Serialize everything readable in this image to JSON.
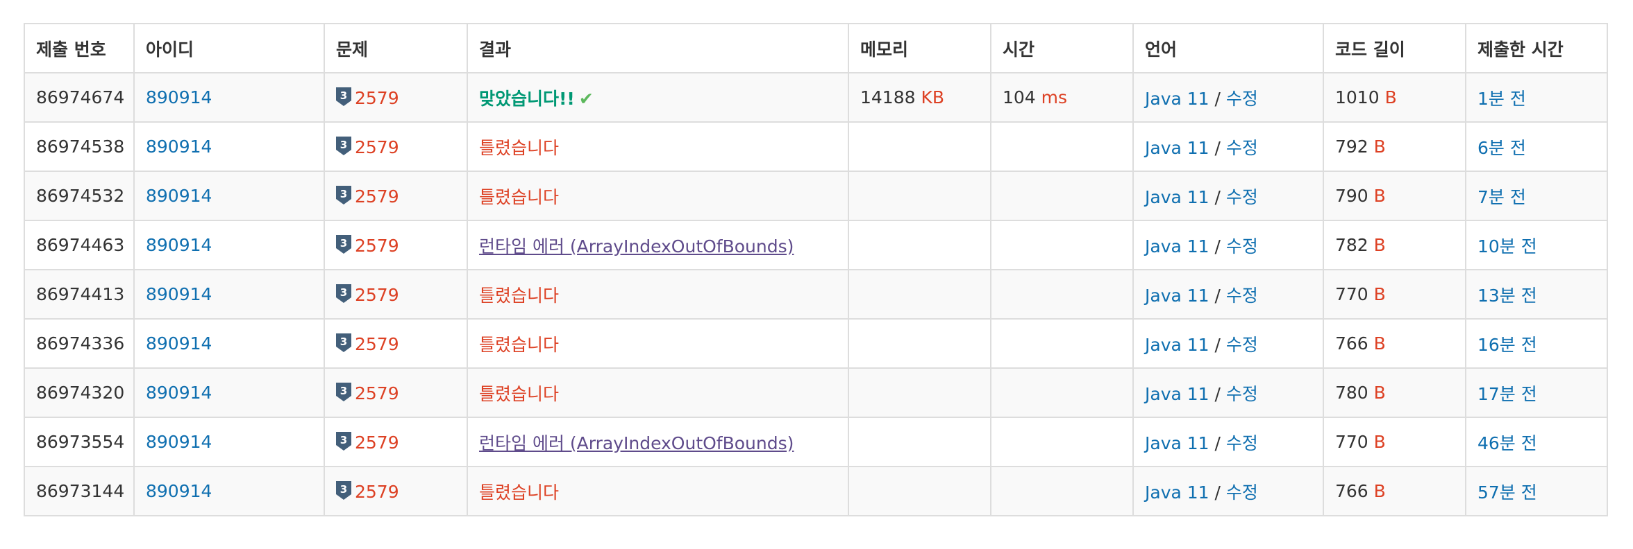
{
  "columns": {
    "submission_id": "제출 번호",
    "user_id": "아이디",
    "problem": "문제",
    "result": "결과",
    "memory": "메모리",
    "time": "시간",
    "language": "언어",
    "code_length": "코드 길이",
    "submitted_at": "제출한 시간"
  },
  "tier_badge": {
    "icon": "silver-tier-badge-icon",
    "level": "3",
    "color": "#435f7a"
  },
  "rows": [
    {
      "submission_id": "86974674",
      "user_id": "890914",
      "problem": "2579",
      "result": "맞았습니다!!",
      "result_type": "accepted",
      "result_icon": "✔",
      "memory": "14188",
      "memory_unit": "KB",
      "time": "104",
      "time_unit": "ms",
      "language": "Java 11",
      "separator": "/",
      "edit": "수정",
      "code_length": "1010",
      "code_unit": "B",
      "submitted_at": "1분 전"
    },
    {
      "submission_id": "86974538",
      "user_id": "890914",
      "problem": "2579",
      "result": "틀렸습니다",
      "result_type": "wrong",
      "memory": "",
      "memory_unit": "",
      "time": "",
      "time_unit": "",
      "language": "Java 11",
      "separator": "/",
      "edit": "수정",
      "code_length": "792",
      "code_unit": "B",
      "submitted_at": "6분 전"
    },
    {
      "submission_id": "86974532",
      "user_id": "890914",
      "problem": "2579",
      "result": "틀렸습니다",
      "result_type": "wrong",
      "memory": "",
      "memory_unit": "",
      "time": "",
      "time_unit": "",
      "language": "Java 11",
      "separator": "/",
      "edit": "수정",
      "code_length": "790",
      "code_unit": "B",
      "submitted_at": "7분 전"
    },
    {
      "submission_id": "86974463",
      "user_id": "890914",
      "problem": "2579",
      "result": "런타임 에러 (ArrayIndexOutOfBounds)",
      "result_type": "runtime-error",
      "memory": "",
      "memory_unit": "",
      "time": "",
      "time_unit": "",
      "language": "Java 11",
      "separator": "/",
      "edit": "수정",
      "code_length": "782",
      "code_unit": "B",
      "submitted_at": "10분 전"
    },
    {
      "submission_id": "86974413",
      "user_id": "890914",
      "problem": "2579",
      "result": "틀렸습니다",
      "result_type": "wrong",
      "memory": "",
      "memory_unit": "",
      "time": "",
      "time_unit": "",
      "language": "Java 11",
      "separator": "/",
      "edit": "수정",
      "code_length": "770",
      "code_unit": "B",
      "submitted_at": "13분 전"
    },
    {
      "submission_id": "86974336",
      "user_id": "890914",
      "problem": "2579",
      "result": "틀렸습니다",
      "result_type": "wrong",
      "memory": "",
      "memory_unit": "",
      "time": "",
      "time_unit": "",
      "language": "Java 11",
      "separator": "/",
      "edit": "수정",
      "code_length": "766",
      "code_unit": "B",
      "submitted_at": "16분 전"
    },
    {
      "submission_id": "86974320",
      "user_id": "890914",
      "problem": "2579",
      "result": "틀렸습니다",
      "result_type": "wrong",
      "memory": "",
      "memory_unit": "",
      "time": "",
      "time_unit": "",
      "language": "Java 11",
      "separator": "/",
      "edit": "수정",
      "code_length": "780",
      "code_unit": "B",
      "submitted_at": "17분 전"
    },
    {
      "submission_id": "86973554",
      "user_id": "890914",
      "problem": "2579",
      "result": "런타임 에러 (ArrayIndexOutOfBounds)",
      "result_type": "runtime-error",
      "memory": "",
      "memory_unit": "",
      "time": "",
      "time_unit": "",
      "language": "Java 11",
      "separator": "/",
      "edit": "수정",
      "code_length": "770",
      "code_unit": "B",
      "submitted_at": "46분 전"
    },
    {
      "submission_id": "86973144",
      "user_id": "890914",
      "problem": "2579",
      "result": "틀렸습니다",
      "result_type": "wrong",
      "memory": "",
      "memory_unit": "",
      "time": "",
      "time_unit": "",
      "language": "Java 11",
      "separator": "/",
      "edit": "수정",
      "code_length": "766",
      "code_unit": "B",
      "submitted_at": "57분 전"
    }
  ],
  "colors": {
    "link": "#0f6fb0",
    "accepted": "#009874",
    "wrong": "#dd4124",
    "runtime_error": "#5f4b8b",
    "unit": "#dd4124",
    "check": "#5cb85c",
    "border": "#dddddd",
    "stripe": "#f9f9f9"
  }
}
